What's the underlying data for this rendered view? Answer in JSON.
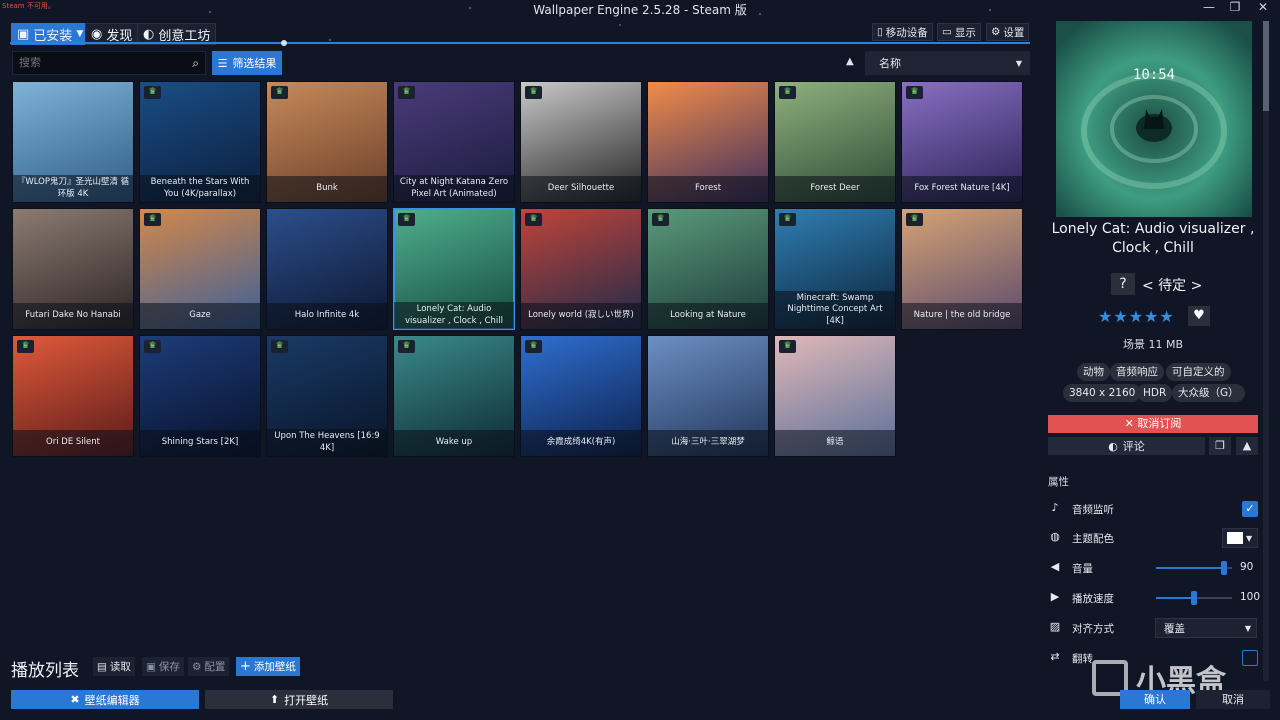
{
  "window": {
    "title": "Wallpaper Engine 2.5.28 - Steam 版",
    "steam_warning": "Steam 不可用。",
    "controls": [
      "minimize-icon",
      "restore-icon",
      "close-icon"
    ]
  },
  "tabs": [
    {
      "label": "已安装",
      "icon": "save-icon",
      "active": true
    },
    {
      "label": "发现",
      "icon": "compass-icon",
      "active": false
    },
    {
      "label": "创意工坊",
      "icon": "steam-icon",
      "active": false
    }
  ],
  "toolbar_right": [
    {
      "label": "移动设备",
      "icon": "phone-icon"
    },
    {
      "label": "显示",
      "icon": "monitor-icon"
    },
    {
      "label": "设置",
      "icon": "gear-icon"
    }
  ],
  "search": {
    "placeholder": "搜索"
  },
  "filter": {
    "label": "筛选结果"
  },
  "sort": {
    "label": "名称"
  },
  "wallpapers": [
    {
      "title": "『WLOP鬼刀』圣光山壁清 循环版 4K",
      "trophy": false,
      "colors": [
        "#7fb3d6",
        "#2e5c87"
      ]
    },
    {
      "title": "Beneath the Stars With You (4K/parallax)",
      "trophy": true,
      "colors": [
        "#1a4e86",
        "#0b1d3b"
      ]
    },
    {
      "title": "Bunk",
      "trophy": true,
      "colors": [
        "#c78a5a",
        "#6b3f2a"
      ]
    },
    {
      "title": "City at Night Katana Zero Pixel Art (Animated)",
      "trophy": true,
      "colors": [
        "#4a3c7a",
        "#1b1a3d"
      ]
    },
    {
      "title": "Deer Silhouette",
      "trophy": true,
      "colors": [
        "#c9c9c9",
        "#222222"
      ]
    },
    {
      "title": "Forest",
      "trophy": false,
      "colors": [
        "#f08c4a",
        "#3b2d5e"
      ]
    },
    {
      "title": "Forest Deer",
      "trophy": true,
      "colors": [
        "#8fb07e",
        "#2d4a35"
      ]
    },
    {
      "title": "Fox Forest Nature [4K]",
      "trophy": true,
      "colors": [
        "#8a6fc4",
        "#2a2256"
      ]
    },
    {
      "title": "Futari Dake No Hanabi",
      "trophy": false,
      "colors": [
        "#8c7b72",
        "#2b2424"
      ]
    },
    {
      "title": "Gaze",
      "trophy": true,
      "colors": [
        "#d4884a",
        "#3a5f9a"
      ]
    },
    {
      "title": "Halo Infinite 4k",
      "trophy": false,
      "colors": [
        "#2c4f8c",
        "#0c1630"
      ]
    },
    {
      "title": "Lonely Cat: Audio visualizer , Clock , Chill",
      "trophy": true,
      "colors": [
        "#4fb08e",
        "#154a3e"
      ]
    },
    {
      "title": "Lonely world (寂しい世界)",
      "trophy": true,
      "colors": [
        "#c0443a",
        "#1d2a4a"
      ]
    },
    {
      "title": "Looking at Nature",
      "trophy": true,
      "colors": [
        "#5a9a7a",
        "#1d3a3a"
      ]
    },
    {
      "title": "Minecraft: Swamp Nighttime Concept Art [4K]",
      "trophy": true,
      "colors": [
        "#2f7fb4",
        "#0c2238"
      ]
    },
    {
      "title": "Nature | the old bridge",
      "trophy": true,
      "colors": [
        "#d6a274",
        "#5a4a6e"
      ]
    },
    {
      "title": "Ori DE Silent",
      "trophy": true,
      "colors": [
        "#e05a3a",
        "#5a1a1a"
      ]
    },
    {
      "title": "Shining Stars [2K]",
      "trophy": true,
      "colors": [
        "#1d3d7a",
        "#08102a"
      ]
    },
    {
      "title": "Upon The Heavens [16:9 4K]",
      "trophy": true,
      "colors": [
        "#1a3a66",
        "#081428"
      ]
    },
    {
      "title": "Wake up",
      "trophy": true,
      "colors": [
        "#3a8a8a",
        "#0e2a36"
      ]
    },
    {
      "title": "余霞成绮4K(有声)",
      "trophy": true,
      "colors": [
        "#2f6fd0",
        "#0c1f4a"
      ]
    },
    {
      "title": "山海·三叶·三翠湖梦",
      "trophy": false,
      "colors": [
        "#6d8fc4",
        "#20365a"
      ]
    },
    {
      "title": "鲸语",
      "trophy": true,
      "colors": [
        "#e0b8b8",
        "#5a6f9a"
      ]
    }
  ],
  "selected_index": 11,
  "playlist": {
    "title": "播放列表",
    "buttons": [
      {
        "label": "读取",
        "icon": "folder-icon",
        "state": "normal"
      },
      {
        "label": "保存",
        "icon": "save-icon",
        "state": "disabled"
      },
      {
        "label": "配置",
        "icon": "gears-icon",
        "state": "disabled"
      },
      {
        "label": "添加壁纸",
        "icon": "plus-icon",
        "state": "primary"
      }
    ]
  },
  "bottom": {
    "editor": "壁纸编辑器",
    "open": "打开壁纸"
  },
  "preview": {
    "clock": "10:54",
    "title": "Lonely Cat: Audio visualizer , Clock , Chill",
    "rating_q": "?",
    "rating_label": "< 待定 >",
    "stars": "★★★★★",
    "star_count": 5,
    "size_text": "场景 11 MB",
    "tags_row1": [
      "动物",
      "音频响应",
      "可自定义的"
    ],
    "tags_row2": [
      "3840 x 2160",
      "HDR",
      "大众级（G）"
    ],
    "unsubscribe": "取消订阅",
    "comment": "评论"
  },
  "properties": {
    "title": "属性",
    "audio": {
      "label": "音频监听",
      "checked": true
    },
    "theme_color": {
      "label": "主题配色",
      "value": "#ffffff"
    },
    "volume": {
      "label": "音量",
      "value": "90",
      "fraction": 0.9
    },
    "speed": {
      "label": "播放速度",
      "value": "100",
      "fraction": 0.5
    },
    "alignment": {
      "label": "对齐方式",
      "value": "覆盖"
    },
    "flip": {
      "label": "翻转",
      "checked": false
    }
  },
  "actions": {
    "ok": "确认",
    "cancel": "取消"
  },
  "watermark": "小黑盒",
  "accent": "#2b78d4",
  "danger": "#e25252"
}
